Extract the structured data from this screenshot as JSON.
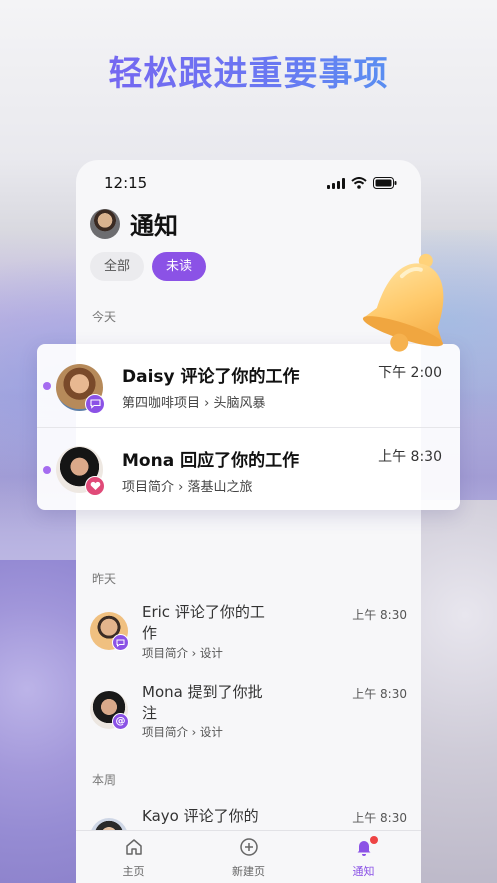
{
  "headline": "轻松跟进重要事项",
  "status": {
    "time": "12:15"
  },
  "page": {
    "title": "通知"
  },
  "filters": {
    "all": "全部",
    "unread": "未读"
  },
  "sections": {
    "today": "今天",
    "yesterday": "昨天",
    "this_week": "本周"
  },
  "featured": [
    {
      "title": "Daisy 评论了你的工作",
      "subtitle": "第四咖啡项目 › 头脑风暴",
      "time": "下午 2:00",
      "badge_icon": "comment-icon"
    },
    {
      "title": "Mona 回应了你的工作",
      "subtitle": "项目简介 › 落基山之旅",
      "time": "上午 8:30",
      "badge_icon": "heart-icon"
    }
  ],
  "yesterday_items": [
    {
      "title": "Eric 评论了你的工作",
      "subtitle": "项目简介 › 设计",
      "time": "上午 8:30",
      "badge_icon": "comment-icon"
    },
    {
      "title": "Mona 提到了你批注",
      "subtitle": "项目简介 › 设计",
      "time": "上午 8:30",
      "badge_icon": "mention-icon"
    }
  ],
  "week_items": [
    {
      "title": "Kayo 评论了你的",
      "time": "上午 8:30"
    }
  ],
  "tabs": [
    {
      "label": "主页",
      "icon": "home-icon"
    },
    {
      "label": "新建页",
      "icon": "add-circle-icon"
    },
    {
      "label": "通知",
      "icon": "bell-icon",
      "active": true
    }
  ],
  "colors": {
    "accent": "#8b52e6",
    "unread_dot": "#a56cf0",
    "tab_badge": "#e44444"
  }
}
